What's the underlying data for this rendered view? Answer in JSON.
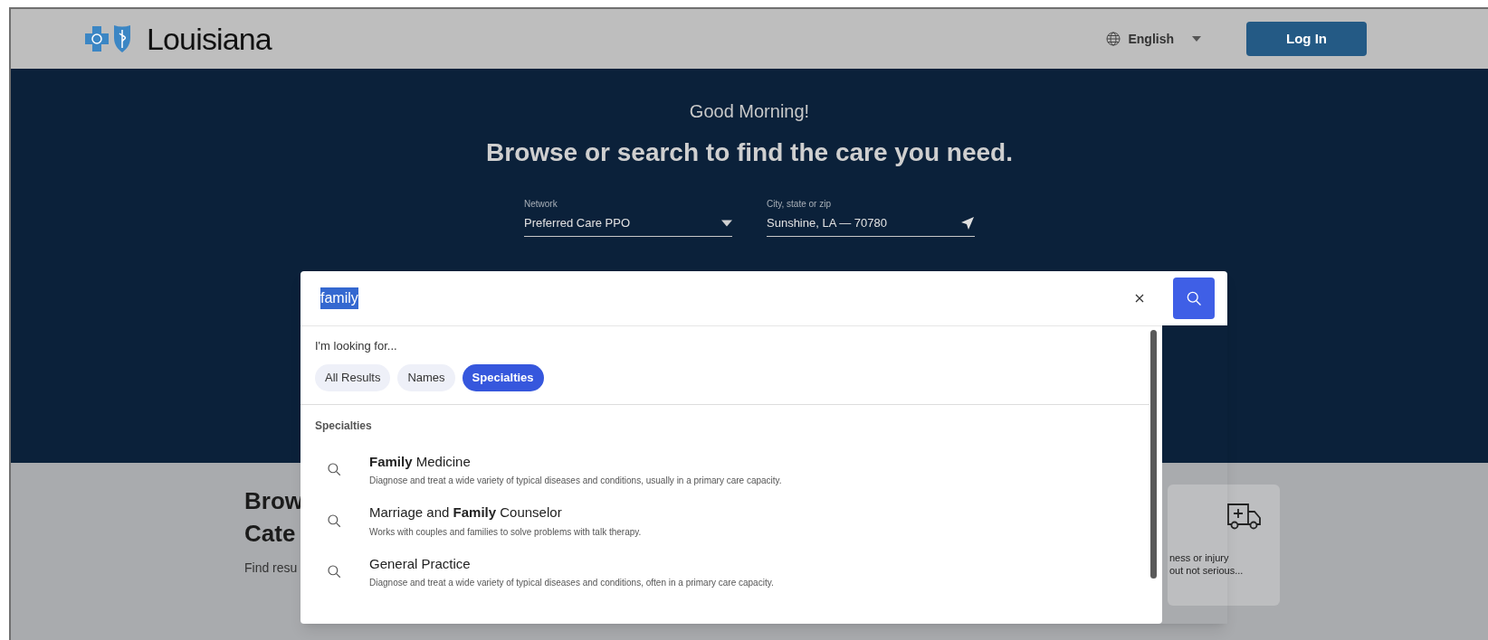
{
  "header": {
    "brand": "Louisiana",
    "language": "English",
    "login": "Log In"
  },
  "hero": {
    "greeting": "Good Morning!",
    "headline": "Browse or search to find the care you need.",
    "fields": [
      {
        "kind": "select",
        "label": "Network",
        "value": "Preferred Care PPO"
      },
      {
        "kind": "location",
        "label": "City, state or zip",
        "value": "Sunshine, LA — 70780"
      }
    ]
  },
  "search": {
    "value": "family",
    "text_selected": true
  },
  "dropdown": {
    "prompt": "I'm looking for...",
    "filters": [
      {
        "label": "All Results",
        "selected": false
      },
      {
        "label": "Names",
        "selected": false
      },
      {
        "label": "Specialties",
        "selected": true
      }
    ],
    "section": "Specialties",
    "results": [
      {
        "title": "**Family** Medicine",
        "description": "Diagnose and treat a wide variety of typical diseases and conditions, usually in a primary care capacity."
      },
      {
        "title": "Marriage and **Family** Counselor",
        "description": "Works with couples and families to solve problems with talk therapy."
      },
      {
        "title": "General Practice",
        "description": "Diagnose and treat a wide variety of typical diseases and conditions, often in a primary care capacity."
      }
    ]
  },
  "browse": {
    "heading_lines": [
      "Brow",
      "Cate"
    ],
    "subtitle": "Find resu",
    "card": {
      "lines": [
        "ness or injury",
        "out not serious..."
      ]
    }
  }
}
